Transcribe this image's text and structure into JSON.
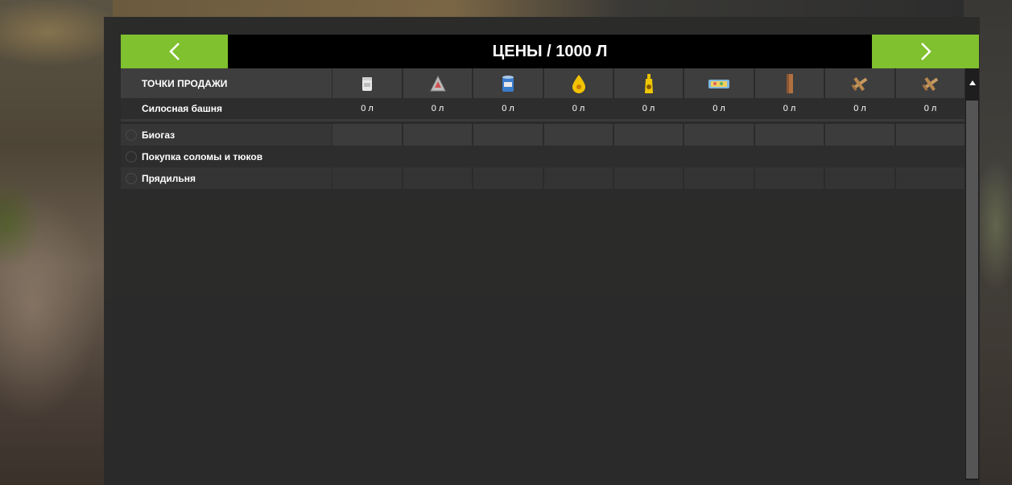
{
  "header": {
    "title": "ЦЕНЫ / 1000 Л",
    "prev_icon": "chevron-left-icon",
    "next_icon": "chevron-right-icon",
    "accent_color": "#7fc12e"
  },
  "table": {
    "header_label": "ТОЧКИ ПРОДАЖИ",
    "columns": [
      {
        "icon": "flour-bag-icon"
      },
      {
        "icon": "fertilizer-pyramid-icon"
      },
      {
        "icon": "butter-can-icon"
      },
      {
        "icon": "sunflower-oil-drop-icon"
      },
      {
        "icon": "sunflower-oil-bottle-icon"
      },
      {
        "icon": "cake-icon"
      },
      {
        "icon": "cardboard-icon"
      },
      {
        "icon": "wooden-toy-plane-icon"
      },
      {
        "icon": "wooden-toy-plane-icon"
      }
    ],
    "silo": {
      "label": "Силосная башня",
      "values": [
        "0 л",
        "0 л",
        "0 л",
        "0 л",
        "0 л",
        "0 л",
        "0 л",
        "0 л",
        "0 л"
      ]
    },
    "rows": [
      {
        "label": "Биогаз",
        "style": "dark"
      },
      {
        "label": "Покупка соломы и тюков",
        "style": "plain"
      },
      {
        "label": "Прядильня",
        "style": "pattern"
      }
    ]
  }
}
